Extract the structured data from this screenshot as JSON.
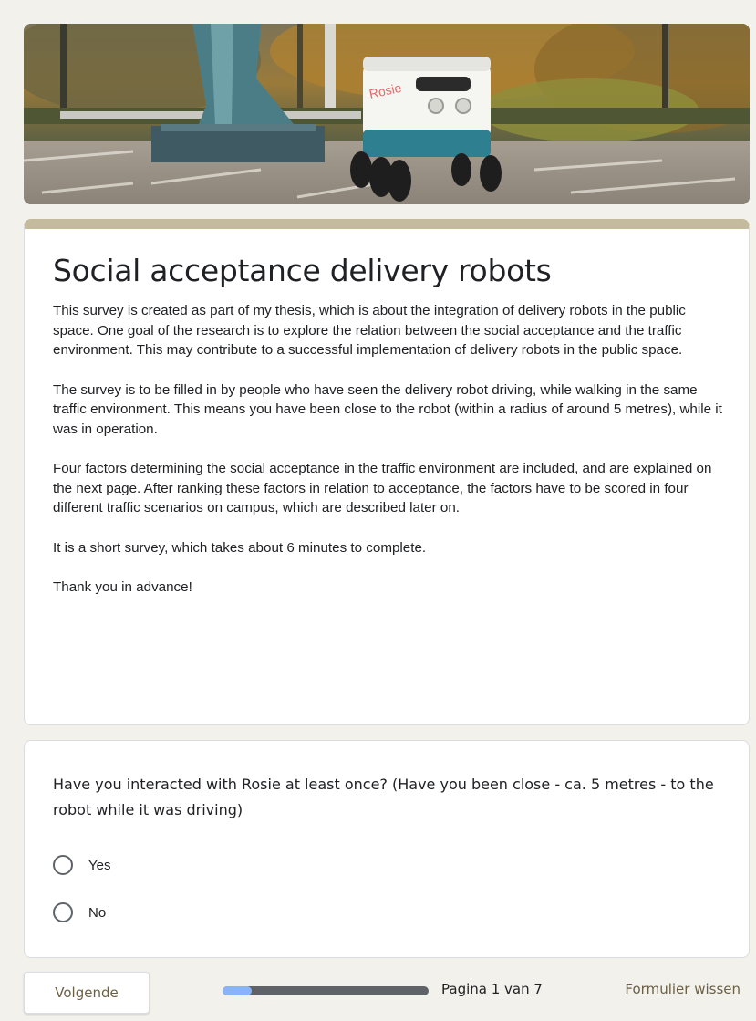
{
  "form": {
    "title": "Social acceptance delivery robots",
    "description": [
      "This survey is created as part of my thesis, which is about the integration of delivery robots in the public space. One goal of the research is to explore the relation between the social acceptance and the traffic environment. This may contribute to a successful implementation of delivery robots in the public space.",
      "The survey is to be filled in by people who have seen the delivery robot driving, while walking in the same traffic environment. This means you have been close to the robot (within a radius of around 5 metres), while it was in operation.",
      "Four factors determining the social acceptance in the traffic environment are included, and are explained on the next page. After ranking these factors in relation to acceptance, the factors have to be scored in four different traffic scenarios on campus, which are described later on.",
      "It is a short survey, which takes about 6 minutes to complete.",
      "Thank you in advance!"
    ],
    "theme_color": "#c4bb9e"
  },
  "banner": {
    "robot_label": "Rosie"
  },
  "question": {
    "text": "Have you interacted with Rosie at least once? (Have you been close - ca. 5 metres - to the robot while it was driving)",
    "options": [
      "Yes",
      "No"
    ]
  },
  "footer": {
    "next_label": "Volgende",
    "page_indicator": "Pagina 1 van 7",
    "progress_fraction": 0.143,
    "clear_label": "Formulier wissen"
  }
}
